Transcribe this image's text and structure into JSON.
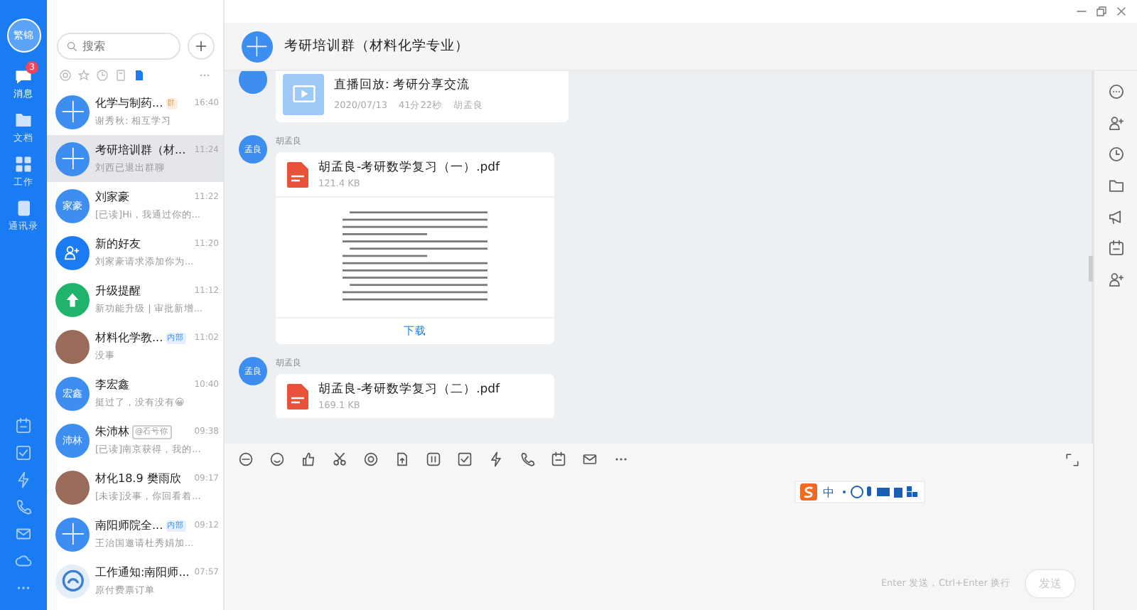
{
  "rail": {
    "avatar_text": "繁锦",
    "nav": [
      {
        "label": "消息",
        "selected": true,
        "badge": "3"
      },
      {
        "label": "文档",
        "selected": false
      },
      {
        "label": "工作",
        "selected": false
      },
      {
        "label": "通讯录",
        "selected": false
      }
    ]
  },
  "chat_list": {
    "search": {
      "placeholder": "搜索"
    },
    "filters": [
      {
        "selected": false
      },
      {
        "selected": false
      },
      {
        "selected": false
      },
      {
        "selected": false
      },
      {
        "selected": true
      }
    ],
    "items": [
      {
        "name": "化学与制药...",
        "tag": {
          "text": "群",
          "kind": "group"
        },
        "time": "16:40",
        "preview": "谢秀秋: 相互学习",
        "kind": "group",
        "selected": false
      },
      {
        "name": "考研培训群（材...",
        "time": "11:24",
        "preview": "刘西已退出群聊",
        "kind": "group",
        "selected": true
      },
      {
        "name": "刘家豪",
        "time": "11:22",
        "preview": "[已读]Hi，我通过你的...",
        "kind": "text",
        "avatar_text": "家豪",
        "selected": false
      },
      {
        "name": "新的好友",
        "time": "11:20",
        "preview": "刘家豪请求添加你为...",
        "kind": "person",
        "selected": false
      },
      {
        "name": "升级提醒",
        "time": "11:12",
        "preview": "新功能升级 | 审批新增...",
        "kind": "up",
        "selected": false
      },
      {
        "name": "材料化学教...",
        "tag": {
          "text": "内部",
          "kind": "internal"
        },
        "time": "11:02",
        "preview": "没事",
        "kind": "photo",
        "selected": false
      },
      {
        "name": "李宏鑫",
        "time": "10:40",
        "preview": "挺过了，没有没有😀",
        "kind": "text",
        "avatar_text": "宏鑫",
        "selected": false
      },
      {
        "name": "朱沛林",
        "tag": {
          "text": "@石号你",
          "kind": "mention"
        },
        "time": "09:38",
        "preview": "[已读]南京获得，我的...",
        "kind": "text",
        "avatar_text": "沛林",
        "selected": false
      },
      {
        "name": "材化18.9 樊雨欣",
        "time": "09:17",
        "preview": "[未读]没事，你回看着...",
        "kind": "photo",
        "selected": false
      },
      {
        "name": "南阳师院全...",
        "tag": {
          "text": "内部",
          "kind": "internal"
        },
        "time": "09:12",
        "preview": "王治国邀请杜秀娟加...",
        "kind": "group",
        "selected": false
      },
      {
        "name": "工作通知:南阳师...",
        "time": "07:57",
        "preview": "原付费票订单",
        "kind": "logo",
        "selected": false
      }
    ]
  },
  "chat": {
    "title": "考研培训群（材料化学专业）",
    "messages": [
      {
        "kind": "video",
        "title": "直播回放: 考研分享交流",
        "date": "2020/07/13",
        "duration": "41分22秒",
        "author": "胡孟良"
      },
      {
        "kind": "file",
        "avatar_text": "孟良",
        "sender": "胡孟良",
        "title": "胡孟良-考研数学复习（一）.pdf",
        "size": "121.4 KB",
        "preview": true,
        "action": "下载"
      },
      {
        "kind": "file",
        "avatar_text": "孟良",
        "sender": "胡孟良",
        "title": "胡孟良-考研数学复习（二）.pdf",
        "size": "169.1 KB",
        "preview": false
      }
    ],
    "ime": {
      "mode": "中"
    },
    "hint": "Enter 发送，Ctrl+Enter 换行",
    "send": {
      "label": "发送",
      "disabled": true
    }
  }
}
